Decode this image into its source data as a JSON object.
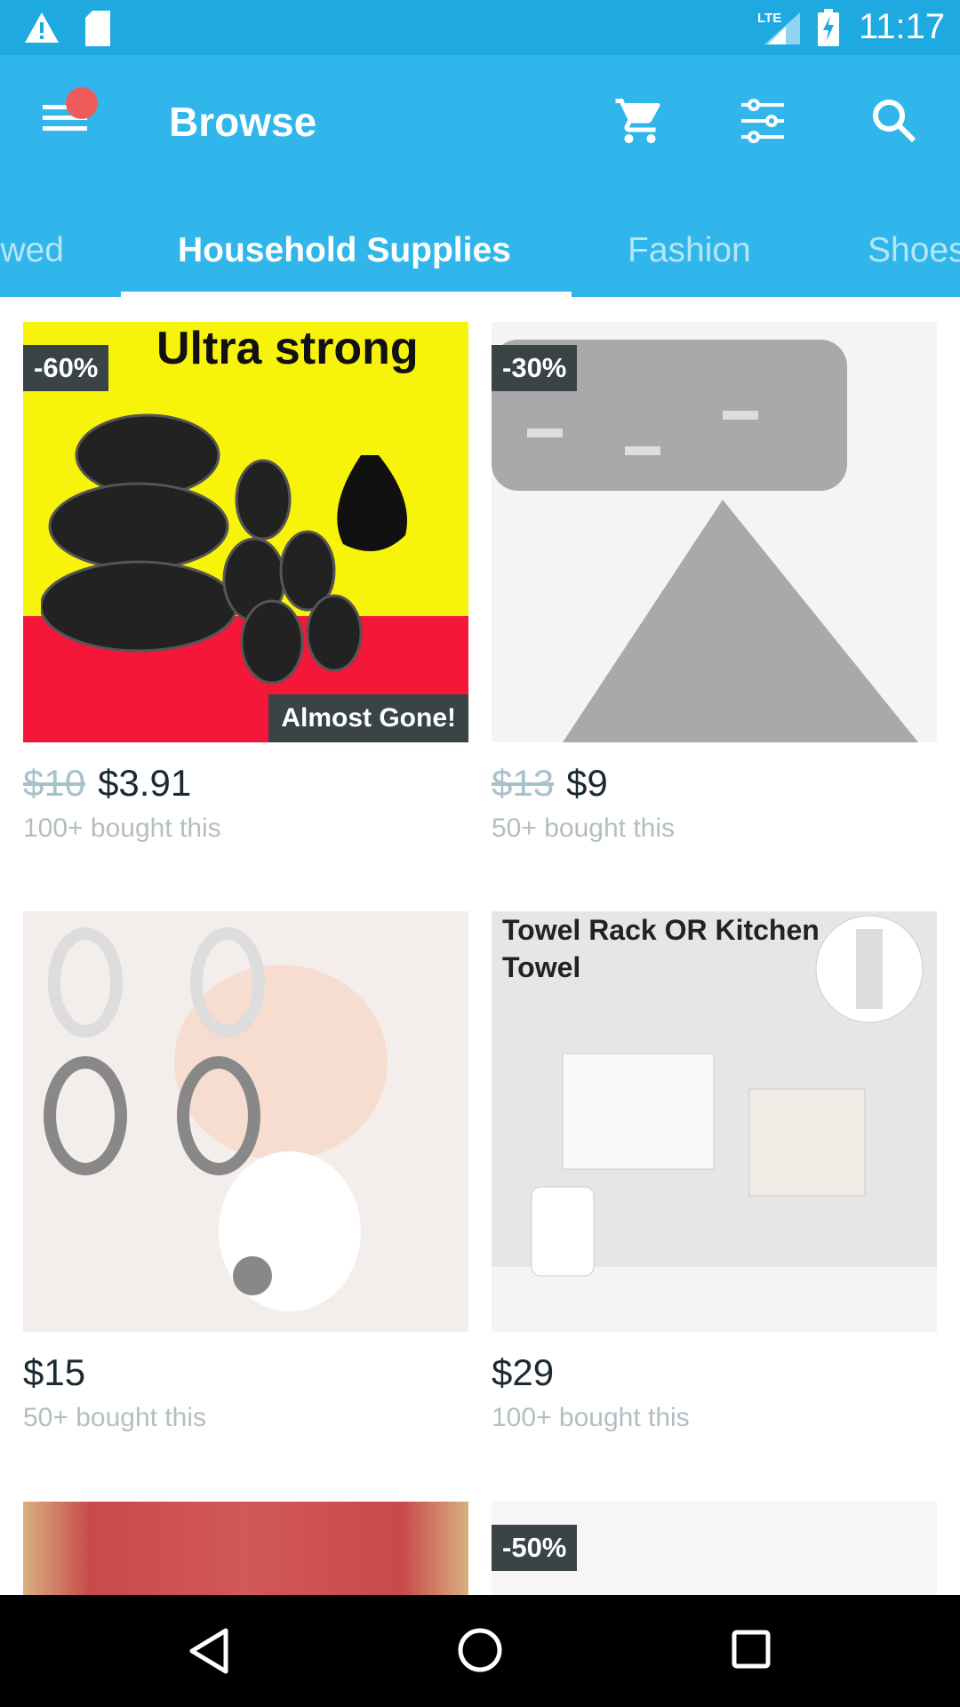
{
  "status_bar": {
    "time": "11:17",
    "network": "LTE",
    "icons": [
      "warning-icon",
      "sd-card-icon",
      "signal-icon",
      "battery-charging-icon"
    ]
  },
  "app_bar": {
    "title": "Browse",
    "icons": [
      "menu-icon",
      "cart-icon",
      "filter-icon",
      "search-icon"
    ],
    "notification_color": "#ef5b5b"
  },
  "tabs": [
    {
      "label": "Recently Viewed",
      "visible_text": "wed"
    },
    {
      "label": "Household Supplies",
      "active": true
    },
    {
      "label": "Fashion"
    },
    {
      "label": "Shoes"
    }
  ],
  "products": [
    {
      "discount": "-60%",
      "old_price": "$10",
      "price": "$3.91",
      "bought": "100+ bought this",
      "tag": "Almost Gone!",
      "image_text": "Ultra strong"
    },
    {
      "discount": "-30%",
      "old_price": "$13",
      "price": "$9",
      "bought": "50+ bought this"
    },
    {
      "price": "$15",
      "bought": "50+ bought this"
    },
    {
      "price": "$29",
      "bought": "100+ bought this",
      "image_text": "Towel Rack OR Kitchen Towel"
    },
    {},
    {
      "discount": "-50%"
    }
  ],
  "colors": {
    "status_bar": "#1fa9e1",
    "app_bar": "#30b6ea",
    "badge": "#3a4446"
  }
}
